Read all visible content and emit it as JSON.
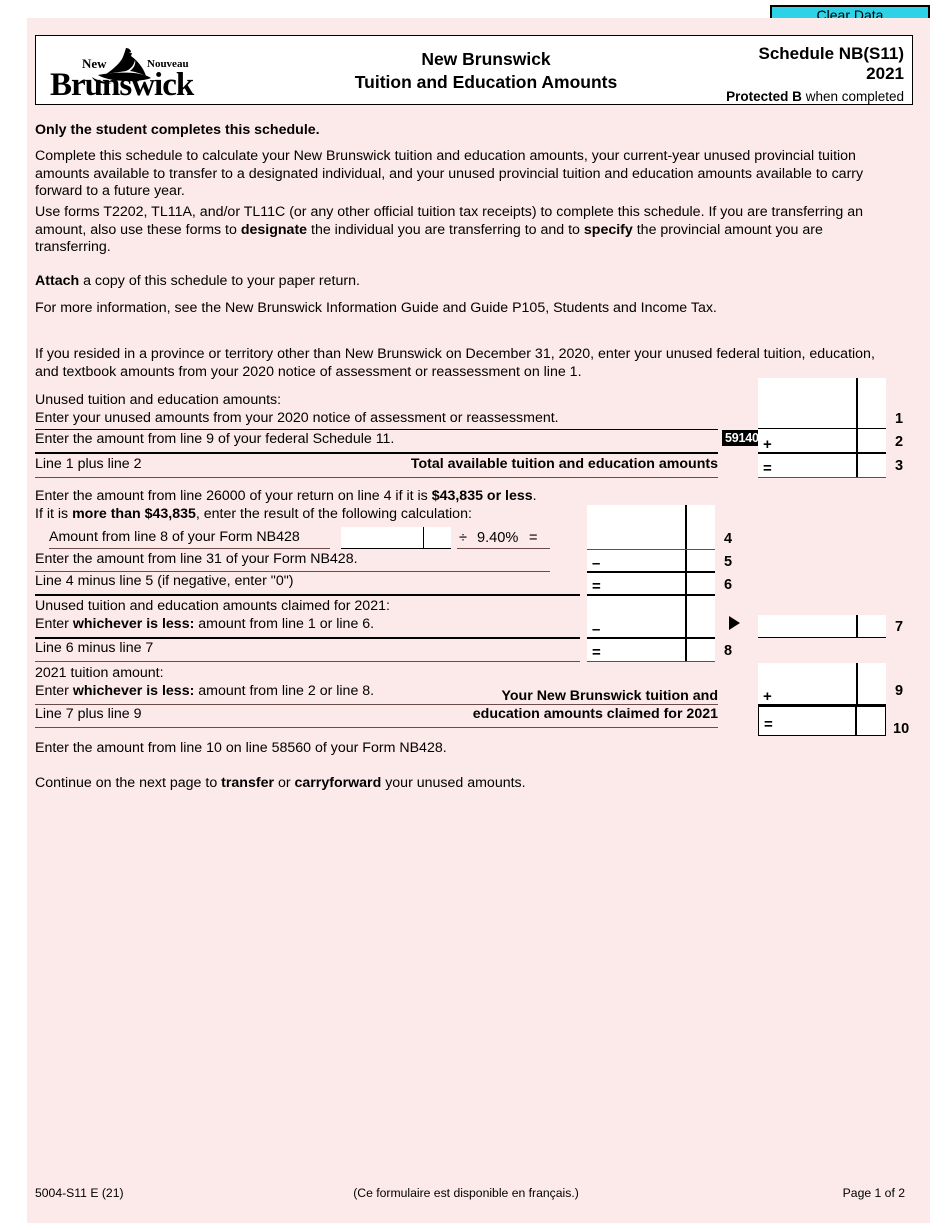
{
  "toolbar": {
    "clear_data_label": "Clear Data"
  },
  "header": {
    "logo_line1_left": "New",
    "logo_line1_right": "Nouveau",
    "logo_line2": "Brunswick",
    "title_line1": "New Brunswick",
    "title_line2": "Tuition and Education Amounts",
    "schedule_id": "Schedule NB(S11)",
    "year": "2021",
    "protected_bold": "Protected B",
    "protected_rest": " when completed"
  },
  "intro": {
    "heading": "Only the student completes this schedule.",
    "p1": "Complete this schedule to calculate your New Brunswick tuition and education amounts, your current-year unused provincial tuition amounts available to transfer to a designated individual, and your unused provincial tuition and education amounts available to carry forward to a future year.",
    "p2_a": "Use forms T2202, TL11A, and/or TL11C (or any other official tuition tax receipts) to complete this schedule. If you are transferring an amount, also use these forms to ",
    "p2_b": "designate",
    "p2_c": " the individual you are transferring to and to ",
    "p2_d": "specify",
    "p2_e": " the provincial amount you are transferring.",
    "p3_a": "Attach",
    "p3_b": " a copy of this schedule to your paper return.",
    "p4": "For more information, see the New Brunswick Information Guide and Guide P105, Students and Income Tax.",
    "p5": "If you resided in a province or territory other than New Brunswick on December 31, 2020, enter your unused federal tuition, education, and textbook amounts from your 2020 notice of assessment or reassessment on line 1."
  },
  "lines": {
    "l1_title": "Unused tuition and education amounts:",
    "l1_text": "Enter your unused amounts from your 2020 notice of assessment or reassessment.",
    "l1_num": "1",
    "l2_text": "Enter the amount from line 9 of your federal Schedule 11.",
    "l2_code": "59140",
    "l2_op": "+",
    "l2_num": "2",
    "l3_text": "Line 1 plus line 2",
    "l3_caption": "Total available tuition and education amounts",
    "l3_op": "=",
    "l3_num": "3",
    "l4_text_a": "Enter the amount from line 26000 of your return on line 4 if it is ",
    "l4_text_b": "$43,835 or less",
    "l4_text_c": ".",
    "l4_text2_a": "If it is ",
    "l4_text2_b": "more than $43,835",
    "l4_text2_c": ", enter the result of the following calculation:",
    "l4_sub_label": "Amount from line 8 of your Form NB428",
    "l4_divide": "÷",
    "l4_rate": "9.40%",
    "l4_equals": "=",
    "l4_num": "4",
    "l5_text": "Enter the amount from line 31 of your Form NB428.",
    "l5_op": "–",
    "l5_num": "5",
    "l6_text": "Line 4 minus line 5 (if negative, enter \"0\")",
    "l6_op": "=",
    "l6_num": "6",
    "l7_title": "Unused tuition and education amounts claimed for 2021:",
    "l7_text_a": "Enter ",
    "l7_text_b": "whichever is less:",
    "l7_text_c": " amount from line 1 or line 6.",
    "l7_op": "–",
    "l7_num": "7",
    "l8_text": "Line 6 minus line 7",
    "l8_op": "=",
    "l8_num": "8",
    "l9_title": "2021 tuition amount:",
    "l9_text_a": "Enter ",
    "l9_text_b": "whichever is less:",
    "l9_text_c": " amount from line 2 or line 8.",
    "l9_op": "+",
    "l9_num": "9",
    "l10_text": "Line 7 plus line 9",
    "l10_caption_1": "Your New Brunswick tuition and",
    "l10_caption_2": "education amounts claimed for 2021",
    "l10_op": "=",
    "l10_num": "10"
  },
  "closing": {
    "p1": "Enter the amount from line 10 on line 58560 of your Form NB428.",
    "p2_a": "Continue on the next page to ",
    "p2_b": "transfer",
    "p2_c": " or ",
    "p2_d": "carryforward",
    "p2_e": " your unused amounts."
  },
  "footer": {
    "form_code": "5004-S11 E (21)",
    "french_note": "(Ce formulaire est disponible en français.)",
    "page_label": "Page 1 of 2"
  },
  "colors": {
    "page_background": "#fce9e9",
    "clear_button": "#2ed2e6",
    "field_code_background": "#000000"
  }
}
